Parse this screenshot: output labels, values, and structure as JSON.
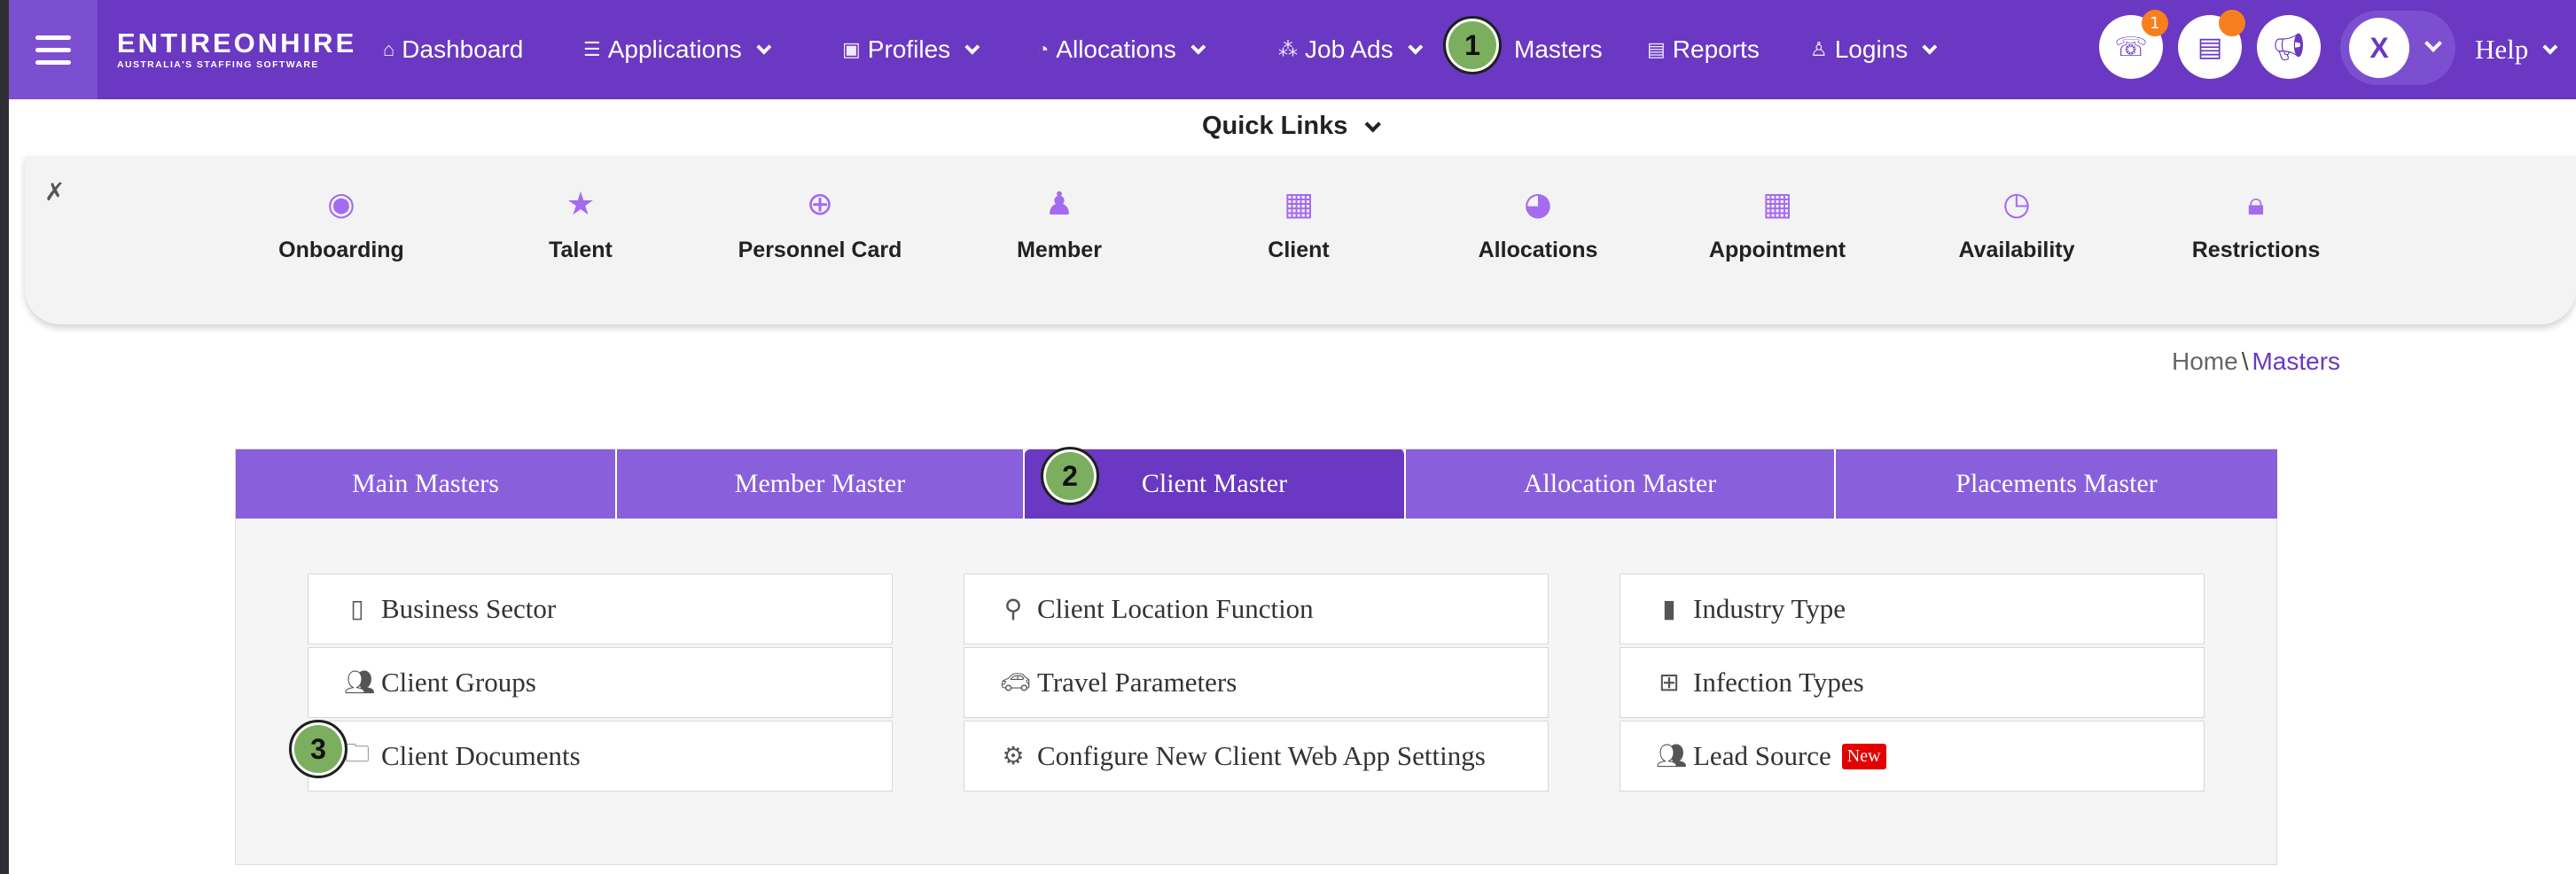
{
  "logo": {
    "brand": "ENTIREONHIRE",
    "tagline": "AUSTRALIA'S STAFFING SOFTWARE"
  },
  "nav": {
    "dashboard": "Dashboard",
    "applications": "Applications",
    "profiles": "Profiles",
    "allocations": "Allocations",
    "job_ads": "Job Ads",
    "masters": "Masters",
    "reports": "Reports",
    "logins": "Logins",
    "help": "Help"
  },
  "header": {
    "calls_badge": "1",
    "user_initial": "X"
  },
  "steps": {
    "s1": "1",
    "s2": "2",
    "s3": "3"
  },
  "quick_links": {
    "title": "Quick Links",
    "items": [
      {
        "label": "Onboarding",
        "icon": "user-circle-icon"
      },
      {
        "label": "Talent",
        "icon": "star-icon"
      },
      {
        "label": "Personnel Card",
        "icon": "search-plus-icon"
      },
      {
        "label": "Member",
        "icon": "user-icon"
      },
      {
        "label": "Client",
        "icon": "building-icon"
      },
      {
        "label": "Allocations",
        "icon": "pie-chart-icon"
      },
      {
        "label": "Appointment",
        "icon": "calendar-icon"
      },
      {
        "label": "Availability",
        "icon": "clock-icon"
      },
      {
        "label": "Restrictions",
        "icon": "lock-icon"
      }
    ]
  },
  "breadcrumb": {
    "home": "Home",
    "separator": "\\",
    "current": "Masters"
  },
  "tabs": [
    {
      "label": "Main Masters"
    },
    {
      "label": "Member Master"
    },
    {
      "label": "Client Master"
    },
    {
      "label": "Allocation Master"
    },
    {
      "label": "Placements Master"
    }
  ],
  "client_master_items": {
    "business_sector": "Business Sector",
    "client_groups": "Client Groups",
    "client_documents": "Client Documents",
    "client_location_function": "Client Location Function",
    "travel_parameters": "Travel Parameters",
    "configure_web_app": "Configure New Client Web App Settings",
    "industry_type": "Industry Type",
    "infection_types": "Infection Types",
    "lead_source": "Lead Source",
    "new_badge": "New"
  },
  "colors": {
    "primary": "#6a38c2",
    "tab": "#8a5fdc",
    "accent_icon": "#a46af0",
    "badge": "#f77f1e",
    "new_badge": "#e30000",
    "step_marker": "#7cae5f"
  }
}
